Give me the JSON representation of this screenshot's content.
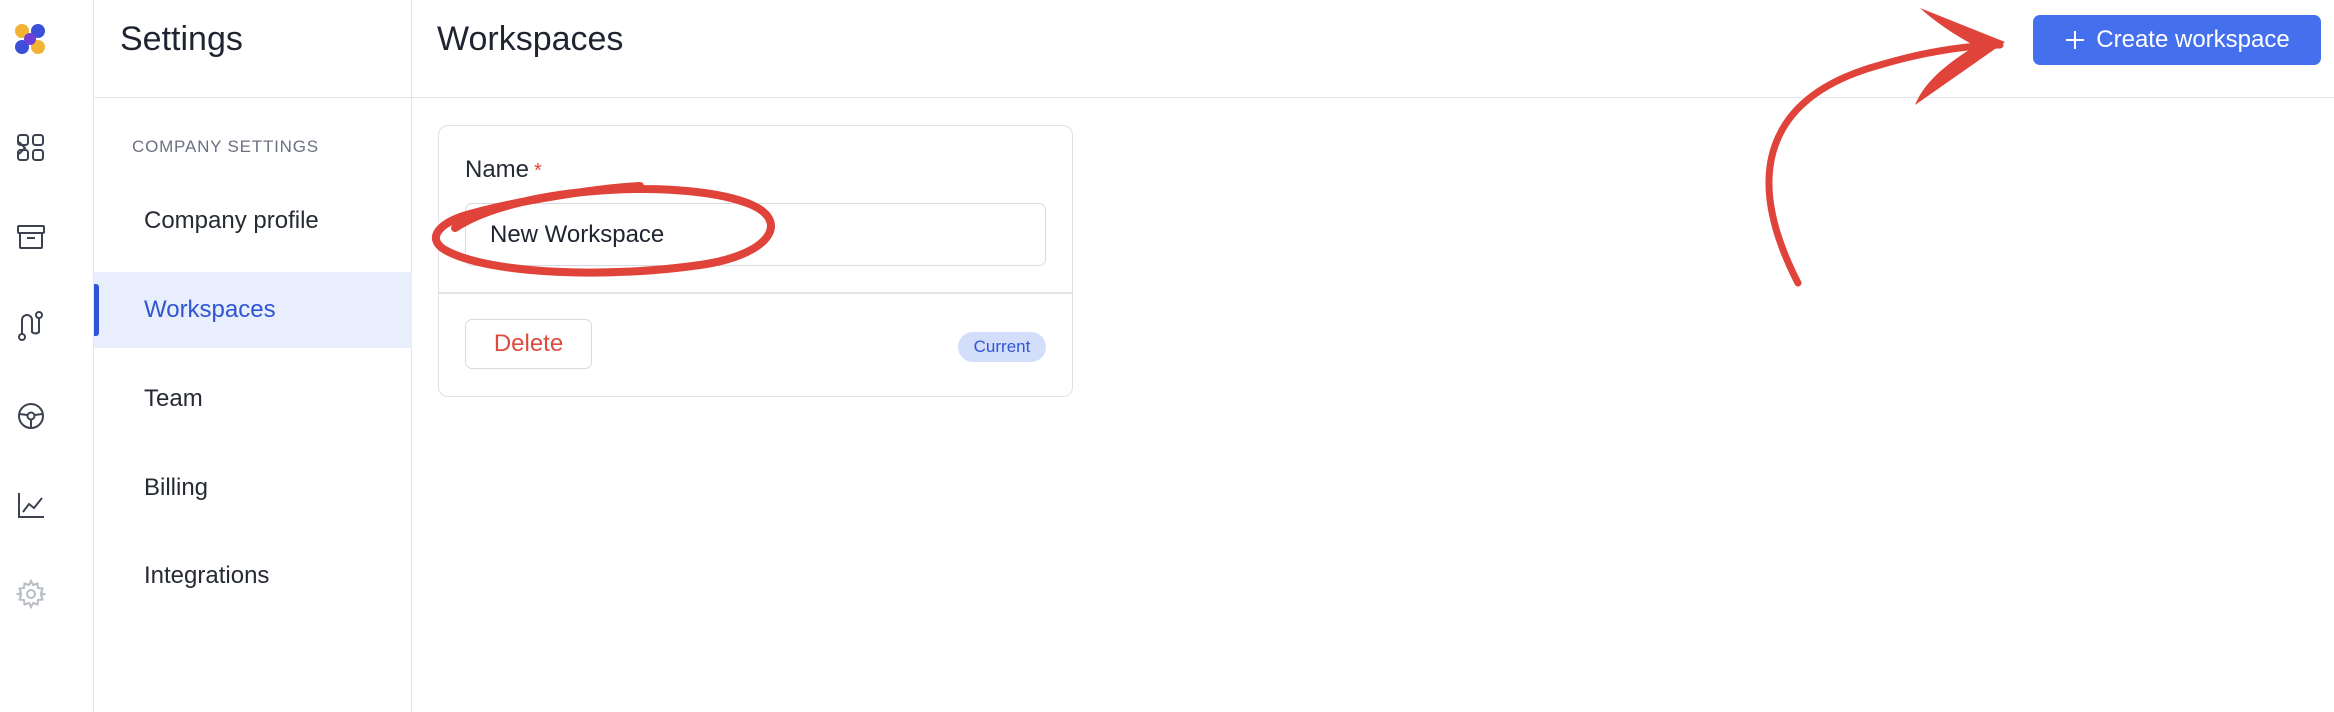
{
  "sidebar": {
    "title": "Settings",
    "section_label": "COMPANY SETTINGS",
    "items": [
      {
        "label": "Company profile",
        "active": false
      },
      {
        "label": "Workspaces",
        "active": true
      },
      {
        "label": "Team",
        "active": false
      },
      {
        "label": "Billing",
        "active": false
      },
      {
        "label": "Integrations",
        "active": false
      }
    ]
  },
  "rail": {
    "icons": [
      "apps-grid-icon",
      "archive-box-icon",
      "route-icon",
      "steering-wheel-icon",
      "line-chart-icon",
      "gear-icon"
    ]
  },
  "main": {
    "title": "Workspaces",
    "create_button_label": "Create workspace",
    "card": {
      "name_label": "Name",
      "required_mark": "*",
      "name_value": "New Workspace",
      "delete_label": "Delete",
      "badge": "Current"
    }
  },
  "colors": {
    "accent": "#4470ee",
    "active_nav_bg": "#e8eefc",
    "danger": "#de4b3e",
    "annotation": "#e0433a"
  }
}
